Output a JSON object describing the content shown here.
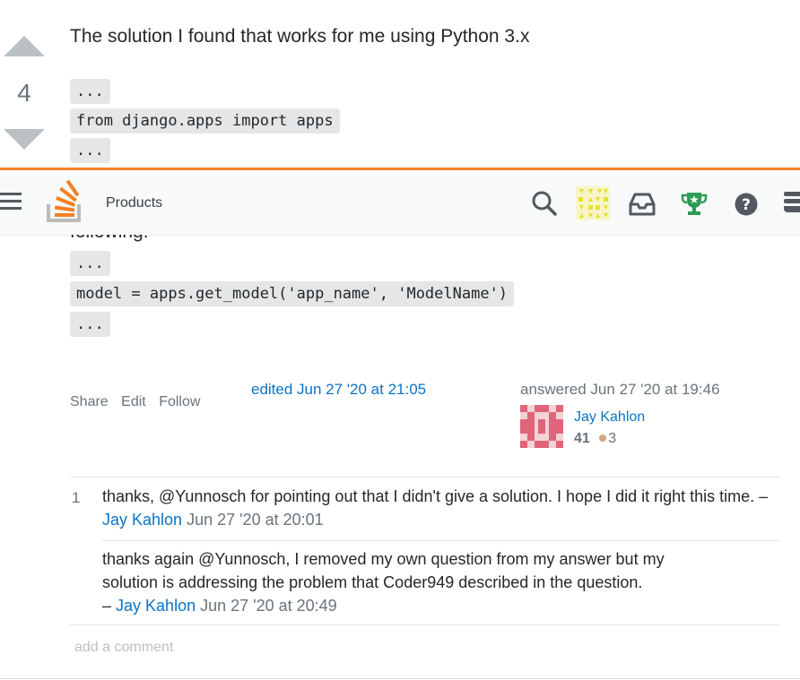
{
  "answer": {
    "intro": "The solution I found that works for me using Python 3.x",
    "vote_count": "4",
    "code_blocks_top": [
      "...",
      "from django.apps import apps",
      "..."
    ],
    "partial_text": "following:",
    "code_blocks_bottom": [
      "...",
      "model = apps.get_model('app_name', 'ModelName')",
      "..."
    ]
  },
  "topbar": {
    "products_label": "Products"
  },
  "post_menu": {
    "share": "Share",
    "edit": "Edit",
    "follow": "Follow"
  },
  "edited": "edited Jun 27 '20 at 21:05",
  "user_card": {
    "action": "answered Jun 27 '20 at 19:46",
    "name": "Jay Kahlon",
    "reputation": "41",
    "bronze": "3"
  },
  "comments": [
    {
      "score": "1",
      "text": "thanks, @Yunnosch for pointing out that I didn't give a solution. I hope I did it right this time. –",
      "user": "Jay Kahlon",
      "date": "Jun 27 '20 at 20:01"
    },
    {
      "score": "",
      "text_line1": "thanks again @Yunnosch, I removed my own question from my answer but my",
      "text_line2": "solution is addressing the problem that Coder949 described in the question.",
      "dash": "–",
      "user": "Jay Kahlon",
      "date": "Jun 27 '20 at 20:49"
    }
  ],
  "add_comment": "add a comment",
  "colors": {
    "accent": "#f48024",
    "link": "#0a74c7",
    "code_bg": "#e4e6e8",
    "bronze": "#d1a684",
    "gold_badge": "#e8e02a",
    "trophy": "#2e9b57"
  }
}
